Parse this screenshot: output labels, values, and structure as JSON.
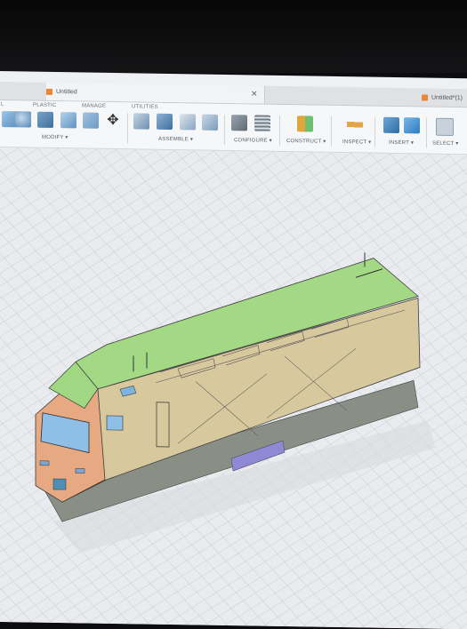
{
  "tabs": [
    {
      "label": "Untitled"
    },
    {
      "label": "Untitled*(1)"
    }
  ],
  "ribbon": {
    "partial_left": "L",
    "plastic": "PLASTIC",
    "manage": "MANAGE",
    "utilities": "UTILITIES"
  },
  "groups": {
    "modify": "MODIFY ▾",
    "assemble": "ASSEMBLE ▾",
    "configure": "CONFIGURE ▾",
    "construct": "CONSTRUCT ▾",
    "inspect": "INSPECT ▾",
    "insert": "INSERT ▾",
    "select": "SELECT ▾"
  },
  "icons": {
    "close": "close-icon",
    "doc": "cube-icon"
  },
  "colors": {
    "body": "#d9c9a0",
    "roof": "#9ed87f",
    "cab": "#e7a982",
    "accent": "#8e89d6"
  }
}
